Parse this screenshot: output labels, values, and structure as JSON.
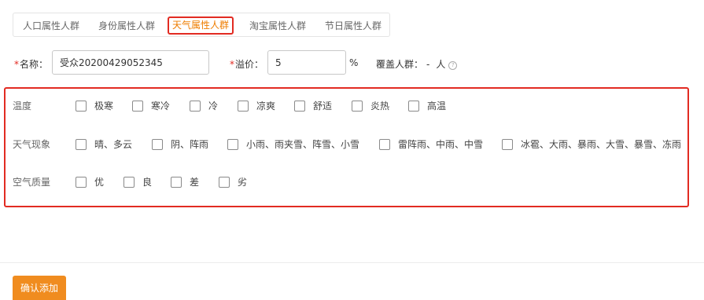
{
  "tabs": [
    {
      "label": "人口属性人群"
    },
    {
      "label": "身份属性人群"
    },
    {
      "label": "天气属性人群"
    },
    {
      "label": "淘宝属性人群"
    },
    {
      "label": "节日属性人群"
    }
  ],
  "active_tab": "天气属性人群",
  "form": {
    "required_mark": "*",
    "name_label": "名称：",
    "name_value": "受众20200429052345",
    "premium_label": "溢价：",
    "premium_value": "5",
    "premium_unit": "%",
    "coverage_label": "覆盖人群：",
    "coverage_value": "-",
    "coverage_unit": "人",
    "help_icon": "?"
  },
  "groups": {
    "temperature": {
      "label": "温度",
      "options": [
        {
          "label": "极寒",
          "checked": false
        },
        {
          "label": "寒冷",
          "checked": false
        },
        {
          "label": "冷",
          "checked": false
        },
        {
          "label": "凉爽",
          "checked": false
        },
        {
          "label": "舒适",
          "checked": false
        },
        {
          "label": "炎热",
          "checked": false
        },
        {
          "label": "高温",
          "checked": false
        }
      ]
    },
    "weather": {
      "label": "天气现象",
      "options": [
        {
          "label": "晴、多云",
          "checked": false
        },
        {
          "label": "阴、阵雨",
          "checked": false
        },
        {
          "label": "小雨、雨夹雪、阵雪、小雪",
          "checked": false
        },
        {
          "label": "雷阵雨、中雨、中雪",
          "checked": false
        },
        {
          "label": "冰雹、大雨、暴雨、大雪、暴雪、冻雨",
          "checked": false
        }
      ]
    },
    "air_quality": {
      "label": "空气质量",
      "options": [
        {
          "label": "优",
          "checked": false
        },
        {
          "label": "良",
          "checked": false
        },
        {
          "label": "差",
          "checked": false
        },
        {
          "label": "劣",
          "checked": false
        }
      ]
    }
  },
  "confirm_label": "确认添加",
  "colors": {
    "accent": "#f08c1f",
    "highlight": "#e22b22",
    "active_tab_text": "#ee7d00"
  }
}
